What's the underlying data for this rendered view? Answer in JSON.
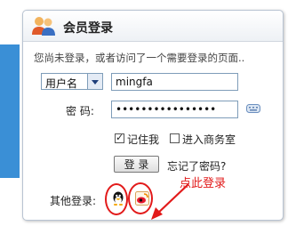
{
  "panel": {
    "title": "会员登录",
    "notice": "您尚未登录，或者访问了一个需要登录的页面.."
  },
  "form": {
    "login_type_selected": "用户名",
    "username_value": "mingfa",
    "password_label": "密 码:",
    "password_value": "••••••••••••••••",
    "remember_label": "记住我",
    "remember_checked": true,
    "business_label": "进入商务室",
    "business_checked": false,
    "login_button": "登 录",
    "forgot_link": "忘记了密码?"
  },
  "other_login": {
    "label": "其他登录:",
    "providers": [
      "qq-icon",
      "sina-weibo-icon"
    ]
  },
  "annotation": {
    "text": "点此登录",
    "color": "#e21a1a"
  },
  "colors": {
    "accent_bar": "#3a8fd6",
    "panel_border": "#b9c4d2"
  }
}
